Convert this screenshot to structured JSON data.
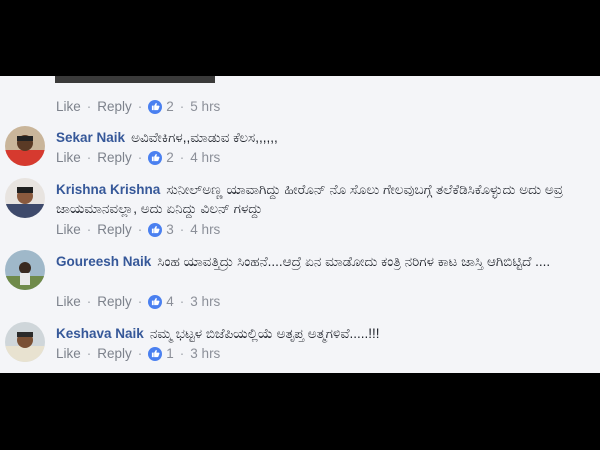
{
  "first_actions": {
    "like": "Like",
    "reply": "Reply",
    "reactions": "2",
    "time": "5 hrs"
  },
  "comments": [
    {
      "author": "Sekar Naik",
      "text": "ಅವಿವೇಕಿಗಳ,,ಮಾಡುವ ಕೆಲಸ,,,,,,",
      "like": "Like",
      "reply": "Reply",
      "reactions": "2",
      "time": "4 hrs"
    },
    {
      "author": "Krishna Krishna",
      "text": "ಸುನೀಲ್ಅಣ್ಣ ಯಾವಾಗಿದ್ದು ಹೀರೊನ್ ನೊ ಸೊಲು ಗೇಲವುಬಗ್ಗೆ ತಲೆಕೆಡಿಸಿಕೊಳ್ಳುದು ಅದು ಅವ್ರ ಜಾಯಮಾನವಲ್ಲಾ, ಅದು ಏನಿದ್ದು ವಿಲನ್ ಗಳದ್ದು",
      "like": "Like",
      "reply": "Reply",
      "reactions": "3",
      "time": "4 hrs"
    },
    {
      "author": "Goureesh Naik",
      "text": "ಸಿಂಹ ಯಾವತ್ತಿದ್ರು ಸಿಂಹನೆ....ಆದ್ರೆ ಏನ ಮಾಡೋದು ಕಂತ್ರಿ ನರಿಗಳ ಕಾಟ ಜಾಸ್ತಿ ಆಗಿಬಿಟ್ಟಿದೆ ....",
      "like": "Like",
      "reply": "Reply",
      "reactions": "4",
      "time": "3 hrs"
    },
    {
      "author": "Keshava Naik",
      "text": "ನಮ್ಮ ಭಟ್ಟಳ ಬಿಜೆಪಿಯಲ್ಲಿಯೆ ಅತೃಪ್ತ ಅತ್ಮಗಳಿವೆ.....!!!",
      "like": "Like",
      "reply": "Reply",
      "reactions": "1",
      "time": "3 hrs"
    }
  ],
  "colors": {
    "name": "#365899",
    "reaction": "#4a80f0",
    "panel": "#f4f5f8",
    "frame": "#000000"
  },
  "icons": {
    "reaction": "thumbs-up-icon"
  }
}
